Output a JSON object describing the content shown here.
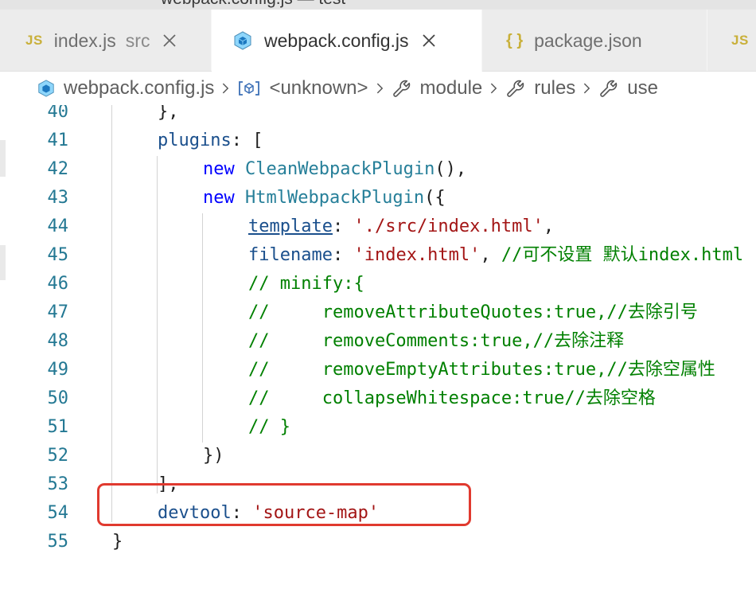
{
  "window": {
    "title": "webpack.config.js — test"
  },
  "tabs": [
    {
      "label": "index.js",
      "sub": "src",
      "icon": "js-icon",
      "icon_text": "JS",
      "active": false,
      "closable": true
    },
    {
      "label": "webpack.config.js",
      "sub": "",
      "icon": "webpack-cube-icon",
      "icon_text": "",
      "active": true,
      "closable": true
    },
    {
      "label": "package.json",
      "sub": "",
      "icon": "json-braces-icon",
      "icon_text": "{ }",
      "active": false,
      "closable": false
    },
    {
      "label": "",
      "sub": "",
      "icon": "js-icon",
      "icon_text": "JS",
      "active": false,
      "closable": false
    }
  ],
  "breadcrumb": [
    {
      "label": "webpack.config.js",
      "icon": "webpack-cube-icon"
    },
    {
      "label": "<unknown>",
      "icon": "variable-icon"
    },
    {
      "label": "module",
      "icon": "wrench-icon"
    },
    {
      "label": "rules",
      "icon": "wrench-icon"
    },
    {
      "label": "use",
      "icon": "wrench-icon"
    }
  ],
  "editor": {
    "lines": [
      {
        "num": "40",
        "indent": 1,
        "tokens": [
          {
            "t": "},",
            "c": "punct"
          }
        ]
      },
      {
        "num": "41",
        "indent": 1,
        "tokens": [
          {
            "t": "plugins",
            "c": "prop"
          },
          {
            "t": ": [",
            "c": "punct"
          }
        ]
      },
      {
        "num": "42",
        "indent": 2,
        "tokens": [
          {
            "t": "new ",
            "c": "kw"
          },
          {
            "t": "CleanWebpackPlugin",
            "c": "cls"
          },
          {
            "t": "(),",
            "c": "punct"
          }
        ]
      },
      {
        "num": "43",
        "indent": 2,
        "tokens": [
          {
            "t": "new ",
            "c": "kw"
          },
          {
            "t": "HtmlWebpackPlugin",
            "c": "cls"
          },
          {
            "t": "({",
            "c": "punct"
          }
        ]
      },
      {
        "num": "44",
        "indent": 3,
        "tokens": [
          {
            "t": "template",
            "c": "prop link"
          },
          {
            "t": ": ",
            "c": "punct"
          },
          {
            "t": "'./src/index.html'",
            "c": "str"
          },
          {
            "t": ",",
            "c": "punct"
          }
        ]
      },
      {
        "num": "45",
        "indent": 3,
        "tokens": [
          {
            "t": "filename",
            "c": "prop"
          },
          {
            "t": ": ",
            "c": "punct"
          },
          {
            "t": "'index.html'",
            "c": "str"
          },
          {
            "t": ", ",
            "c": "punct"
          },
          {
            "t": "//可不设置 默认index.html",
            "c": "cm"
          }
        ]
      },
      {
        "num": "46",
        "indent": 3,
        "tokens": [
          {
            "t": "// minify:{",
            "c": "cm"
          }
        ]
      },
      {
        "num": "47",
        "indent": 3,
        "tokens": [
          {
            "t": "//     removeAttributeQuotes:true,//去除引号",
            "c": "cm"
          }
        ]
      },
      {
        "num": "48",
        "indent": 3,
        "tokens": [
          {
            "t": "//     removeComments:true,//去除注释",
            "c": "cm"
          }
        ]
      },
      {
        "num": "49",
        "indent": 3,
        "tokens": [
          {
            "t": "//     removeEmptyAttributes:true,//去除空属性",
            "c": "cm"
          }
        ]
      },
      {
        "num": "50",
        "indent": 3,
        "tokens": [
          {
            "t": "//     collapseWhitespace:true//去除空格",
            "c": "cm"
          }
        ]
      },
      {
        "num": "51",
        "indent": 3,
        "tokens": [
          {
            "t": "// }",
            "c": "cm"
          }
        ]
      },
      {
        "num": "52",
        "indent": 2,
        "tokens": [
          {
            "t": "})",
            "c": "punct"
          }
        ]
      },
      {
        "num": "53",
        "indent": 1,
        "tokens": [
          {
            "t": "],",
            "c": "punct"
          }
        ]
      },
      {
        "num": "54",
        "indent": 1,
        "tokens": [
          {
            "t": "devtool",
            "c": "prop"
          },
          {
            "t": ": ",
            "c": "punct"
          },
          {
            "t": "'source-map'",
            "c": "str"
          }
        ]
      },
      {
        "num": "55",
        "indent": 0,
        "tokens": [
          {
            "t": "}",
            "c": "punct"
          }
        ]
      }
    ],
    "highlight_line": "54",
    "colors": {
      "line_number": "#237893",
      "property": "#1a4f8c",
      "string": "#a31515",
      "keyword": "#0000ff",
      "class": "#267f99",
      "comment": "#008000",
      "highlight_box": "#e03a2f"
    }
  }
}
